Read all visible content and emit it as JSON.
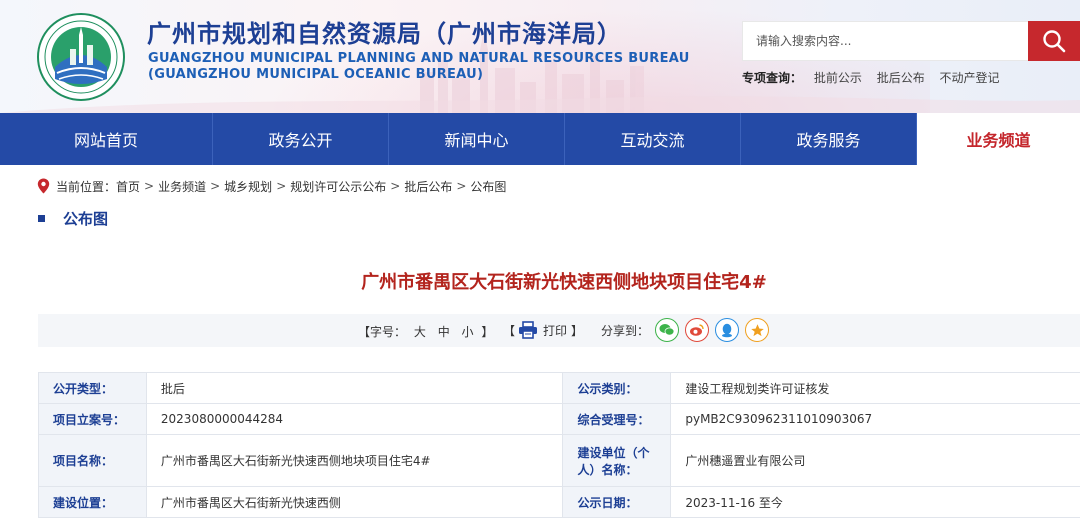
{
  "header": {
    "title_cn": "广州市规划和自然资源局（广州市海洋局）",
    "title_en_line1": "GUANGZHOU MUNICIPAL PLANNING AND NATURAL RESOURCES BUREAU",
    "title_en_line2": "(GUANGZHOU MUNICIPAL OCEANIC BUREAU)",
    "search_placeholder": "请输入搜索内容...",
    "special_label": "专项查询：",
    "special_links": [
      "批前公示",
      "批后公布",
      "不动产登记"
    ]
  },
  "nav": {
    "items": [
      "网站首页",
      "政务公开",
      "新闻中心",
      "互动交流",
      "政务服务",
      "业务频道"
    ],
    "active": "业务频道"
  },
  "breadcrumb": {
    "label": "当前位置：",
    "items": [
      "首页",
      "业务频道",
      "城乡规划",
      "规划许可公示公布",
      "批后公布",
      "公布图"
    ],
    "separator": ">"
  },
  "section": {
    "title": "公布图"
  },
  "article": {
    "title": "广州市番禺区大石街新光快速西侧地块项目住宅4#"
  },
  "toolbar": {
    "font_size_label": "【字号：",
    "size_large": "大",
    "size_medium": "中",
    "size_small": "小",
    "font_size_close": "】",
    "print_open": "【",
    "print_label": "打印",
    "print_close": "】",
    "share_label": "分享到："
  },
  "colors": {
    "brand_blue": "#244aa6",
    "title_blue": "#1d3f94",
    "accent_red": "#c6282d",
    "article_red": "#b3241d"
  },
  "info_table": [
    {
      "k1": "公开类型：",
      "v1": "批后",
      "k2": "公示类别：",
      "v2": "建设工程规划类许可证核发"
    },
    {
      "k1": "项目立案号：",
      "v1": "2023080000044284",
      "k2": "综合受理号：",
      "v2": "pyMB2C930962311010903067"
    },
    {
      "k1": "项目名称：",
      "v1": "广州市番禺区大石街新光快速西侧地块项目住宅4#",
      "k2": "建设单位（个人）名称：",
      "v2": "广州穗遥置业有限公司"
    },
    {
      "k1": "建设位置：",
      "v1": "广州市番禺区大石街新光快速西侧",
      "k2": "公示日期：",
      "v2": "2023-11-16 至今"
    }
  ]
}
